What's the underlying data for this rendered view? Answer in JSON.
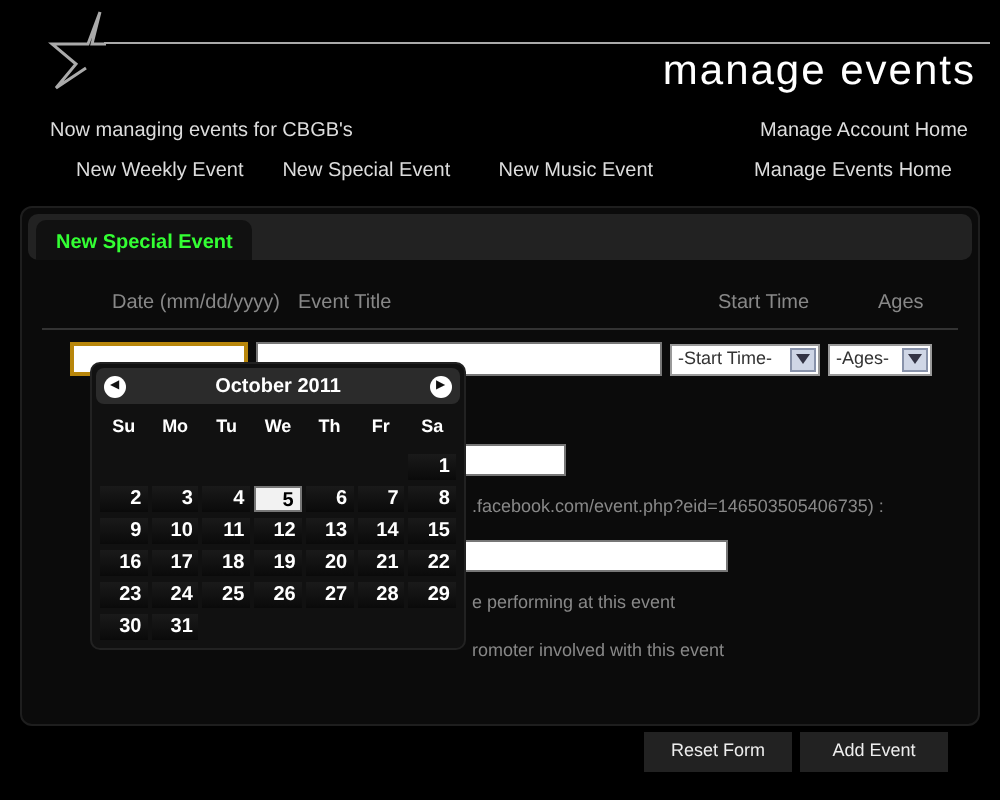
{
  "header": {
    "title": "manage events",
    "managing": "Now managing events for CBGB's",
    "account_link": "Manage Account Home"
  },
  "nav": [
    {
      "label": "New Weekly Event"
    },
    {
      "label": "New Special Event"
    },
    {
      "label": "New Music Event"
    },
    {
      "label": "Manage Events Home"
    }
  ],
  "tabs": [
    {
      "label": "New Special Event",
      "selected": true
    }
  ],
  "columns": [
    "Date (mm/dd/yyyy)",
    "Event Title",
    "Start Time",
    "Ages"
  ],
  "entry": {
    "date_focused": true,
    "start_time": "-Start Time-",
    "ages": "-Ages-"
  },
  "form_lines": [
    {
      "kind": "field"
    },
    {
      "kind": "text",
      "text": ".facebook.com/event.php?eid=146503505406735) :"
    },
    {
      "kind": "wide-field"
    },
    {
      "kind": "text",
      "text": "e performing at this event"
    },
    {
      "kind": "text",
      "text": "romoter involved with this event"
    }
  ],
  "buttons": [
    "Reset Form",
    "Add Event"
  ],
  "calendar": {
    "prev": "◀",
    "next": "▶",
    "month": "October 2011",
    "weekdays": [
      "Su",
      "Mo",
      "Tu",
      "We",
      "Th",
      "Fr",
      "Sa"
    ],
    "weeks": [
      [
        {
          "kind": "blank"
        },
        {
          "kind": "blank"
        },
        {
          "kind": "blank"
        },
        {
          "kind": "blank"
        },
        {
          "kind": "blank"
        },
        {
          "kind": "blank"
        },
        {
          "kind": "day",
          "day": "1",
          "selected": false
        }
      ],
      [
        {
          "day": "2",
          "selected": false
        },
        {
          "day": "3",
          "selected": false
        },
        {
          "day": "4",
          "selected": false
        },
        {
          "day": "5",
          "selected": true
        },
        {
          "day": "6",
          "selected": false
        },
        {
          "day": "7",
          "selected": false
        },
        {
          "day": "8",
          "selected": false
        }
      ],
      [
        {
          "day": "9",
          "selected": false
        },
        {
          "day": "10",
          "selected": false
        },
        {
          "day": "11",
          "selected": false
        },
        {
          "day": "12",
          "selected": false
        },
        {
          "day": "13",
          "selected": false
        },
        {
          "day": "14",
          "selected": false
        },
        {
          "day": "15",
          "selected": false
        }
      ],
      [
        {
          "day": "16",
          "selected": false
        },
        {
          "day": "17",
          "selected": false
        },
        {
          "day": "18",
          "selected": false
        },
        {
          "day": "19",
          "selected": false
        },
        {
          "day": "20",
          "selected": false
        },
        {
          "day": "21",
          "selected": false
        },
        {
          "day": "22",
          "selected": false
        }
      ],
      [
        {
          "day": "23",
          "selected": false
        },
        {
          "day": "24",
          "selected": false
        },
        {
          "day": "25",
          "selected": false
        },
        {
          "day": "26",
          "selected": false
        },
        {
          "day": "27",
          "selected": false
        },
        {
          "day": "28",
          "selected": false
        },
        {
          "day": "29",
          "selected": false
        }
      ],
      [
        {
          "day": "30",
          "selected": false
        },
        {
          "day": "31",
          "selected": false
        },
        {
          "kind": "blank"
        },
        {
          "kind": "blank"
        },
        {
          "kind": "blank"
        },
        {
          "kind": "blank"
        },
        {
          "kind": "blank"
        }
      ]
    ]
  }
}
